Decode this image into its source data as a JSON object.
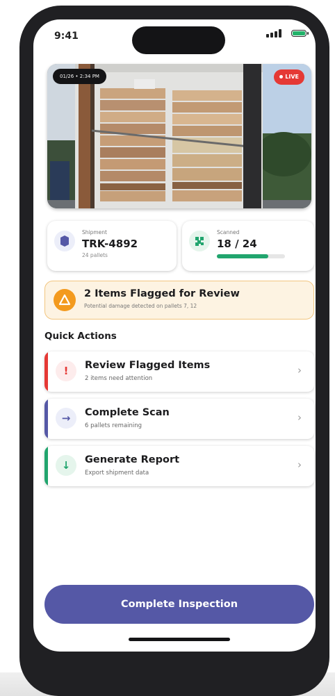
{
  "status_bar": {
    "time": "9:41"
  },
  "camera": {
    "timestamp": "01/26 • 2:34 PM",
    "live_label": "LIVE"
  },
  "shipment": {
    "label": "Shipment",
    "id": "TRK-4892",
    "sub": "24 pallets"
  },
  "scanned": {
    "label": "Scanned",
    "value": "18 / 24",
    "progress": 0.75
  },
  "alert": {
    "title": "2 Items Flagged for Review",
    "subtitle": "Potential damage detected on pallets 7, 12"
  },
  "quick_actions": {
    "title": "Quick Actions",
    "items": [
      {
        "title": "Review Flagged Items",
        "subtitle": "2 items need attention",
        "icon": "!",
        "color": "#e53935"
      },
      {
        "title": "Complete Scan",
        "subtitle": "6 pallets remaining",
        "icon": "→",
        "color": "#5558a6"
      },
      {
        "title": "Generate Report",
        "subtitle": "Export shipment data",
        "icon": "↓",
        "color": "#21a56e"
      }
    ]
  },
  "primary_button": {
    "label": "Complete Inspection"
  },
  "colors": {
    "accent": "#5558a6",
    "success": "#21a56e",
    "danger": "#e53935",
    "warning": "#f39a1e"
  }
}
